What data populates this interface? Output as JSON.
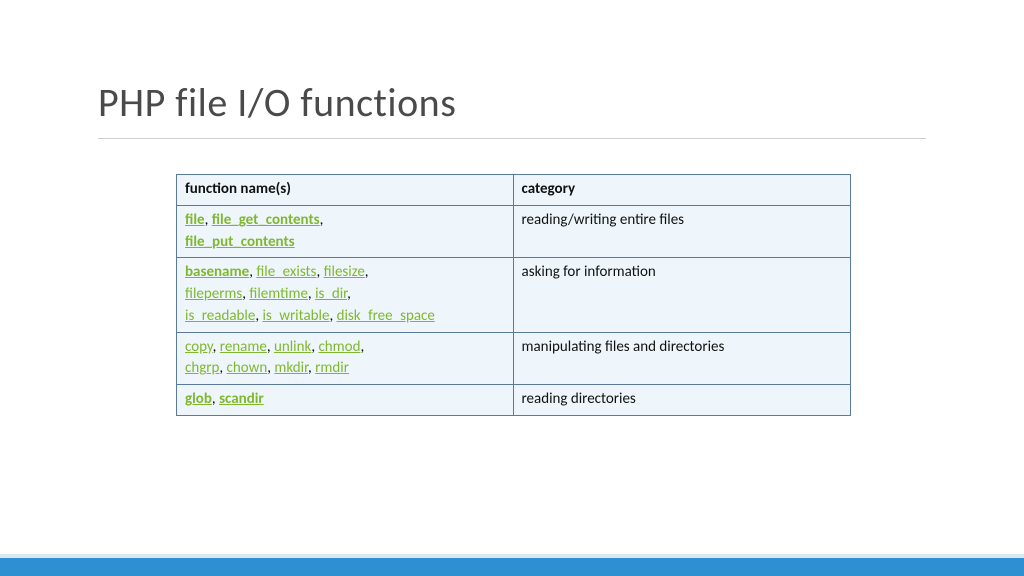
{
  "title": "PHP file I/O functions",
  "headers": {
    "functions": "function name(s)",
    "category": "category"
  },
  "rows": [
    {
      "functions": [
        {
          "name": "file",
          "bold": true
        },
        {
          "name": "file_get_contents",
          "bold": true
        },
        {
          "name": "file_put_contents",
          "bold": true
        }
      ],
      "category": "reading/writing entire files"
    },
    {
      "functions": [
        {
          "name": "basename",
          "bold": true
        },
        {
          "name": "file_exists",
          "bold": false
        },
        {
          "name": "filesize",
          "bold": false
        },
        {
          "name": "fileperms",
          "bold": false
        },
        {
          "name": "filemtime",
          "bold": false
        },
        {
          "name": "is_dir",
          "bold": false
        },
        {
          "name": "is_readable",
          "bold": false
        },
        {
          "name": "is_writable",
          "bold": false
        },
        {
          "name": "disk_free_space",
          "bold": false
        }
      ],
      "category": "asking for information"
    },
    {
      "functions": [
        {
          "name": "copy",
          "bold": false
        },
        {
          "name": "rename",
          "bold": false
        },
        {
          "name": "unlink",
          "bold": false
        },
        {
          "name": "chmod",
          "bold": false
        },
        {
          "name": "chgrp",
          "bold": false
        },
        {
          "name": "chown",
          "bold": false
        },
        {
          "name": "mkdir",
          "bold": false
        },
        {
          "name": "rmdir",
          "bold": false
        }
      ],
      "category": "manipulating files and directories"
    },
    {
      "functions": [
        {
          "name": "glob",
          "bold": true
        },
        {
          "name": "scandir",
          "bold": true
        }
      ],
      "category": "reading directories"
    }
  ],
  "row_breaks": [
    [
      2
    ],
    [
      3,
      6
    ],
    [
      4
    ],
    []
  ]
}
